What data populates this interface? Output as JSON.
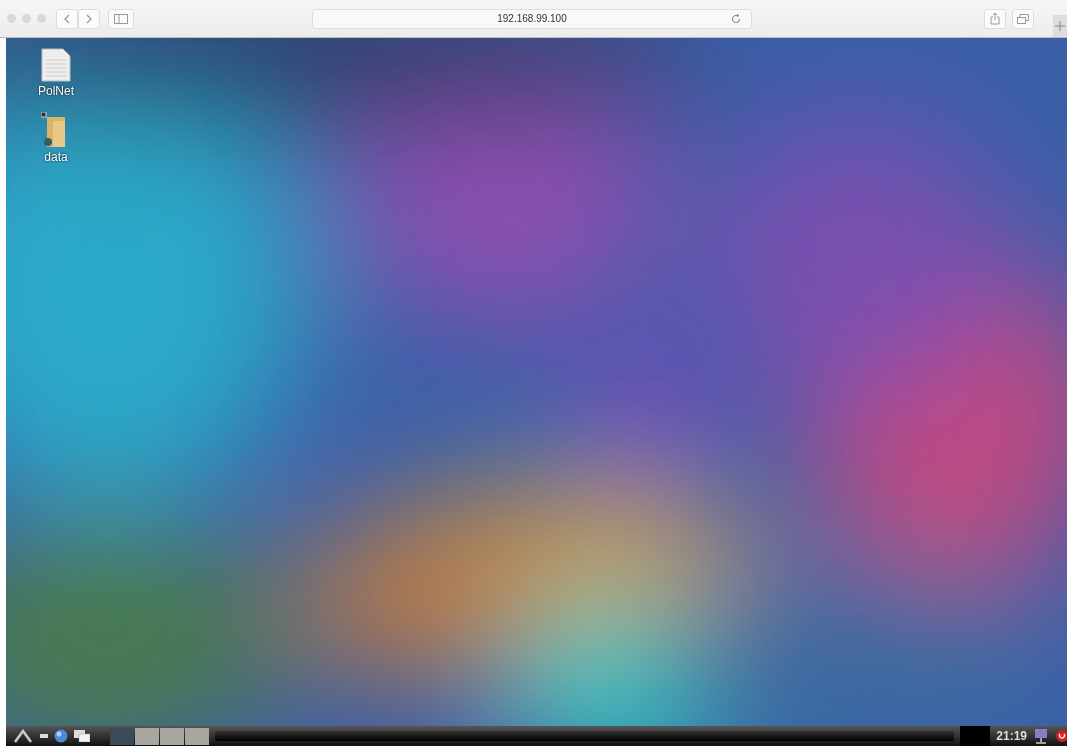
{
  "browser": {
    "url": "192.168.99.100"
  },
  "desktop": {
    "icons": [
      {
        "label": "PolNet",
        "kind": "document"
      },
      {
        "label": "data",
        "kind": "folder"
      }
    ]
  },
  "taskbar": {
    "workspaces": [
      {
        "selected": true
      },
      {
        "selected": false
      },
      {
        "selected": false
      },
      {
        "selected": false
      }
    ],
    "clock": "21:19"
  }
}
